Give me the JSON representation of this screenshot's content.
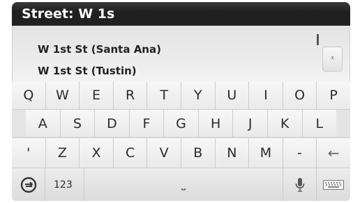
{
  "search": {
    "label": "Street: W 1s"
  },
  "results": [
    {
      "label": "W 1st St (Santa Ana)"
    },
    {
      "label": "W 1st St (Tustin)"
    }
  ],
  "scroll": {
    "down_glyph": "⩡"
  },
  "keyboard": {
    "row1": [
      "Q",
      "W",
      "E",
      "R",
      "T",
      "Y",
      "U",
      "I",
      "O",
      "P"
    ],
    "row2": [
      "A",
      "S",
      "D",
      "F",
      "G",
      "H",
      "J",
      "K",
      "L"
    ],
    "row3": [
      "'",
      "Z",
      "X",
      "C",
      "V",
      "B",
      "N",
      "M",
      "-"
    ],
    "backspace_glyph": "←",
    "switch_glyph": "⟲",
    "numbers_label": "123",
    "space_glyph": "⎵",
    "mic_glyph": "🎙",
    "keyboard_glyph": "⌨"
  }
}
